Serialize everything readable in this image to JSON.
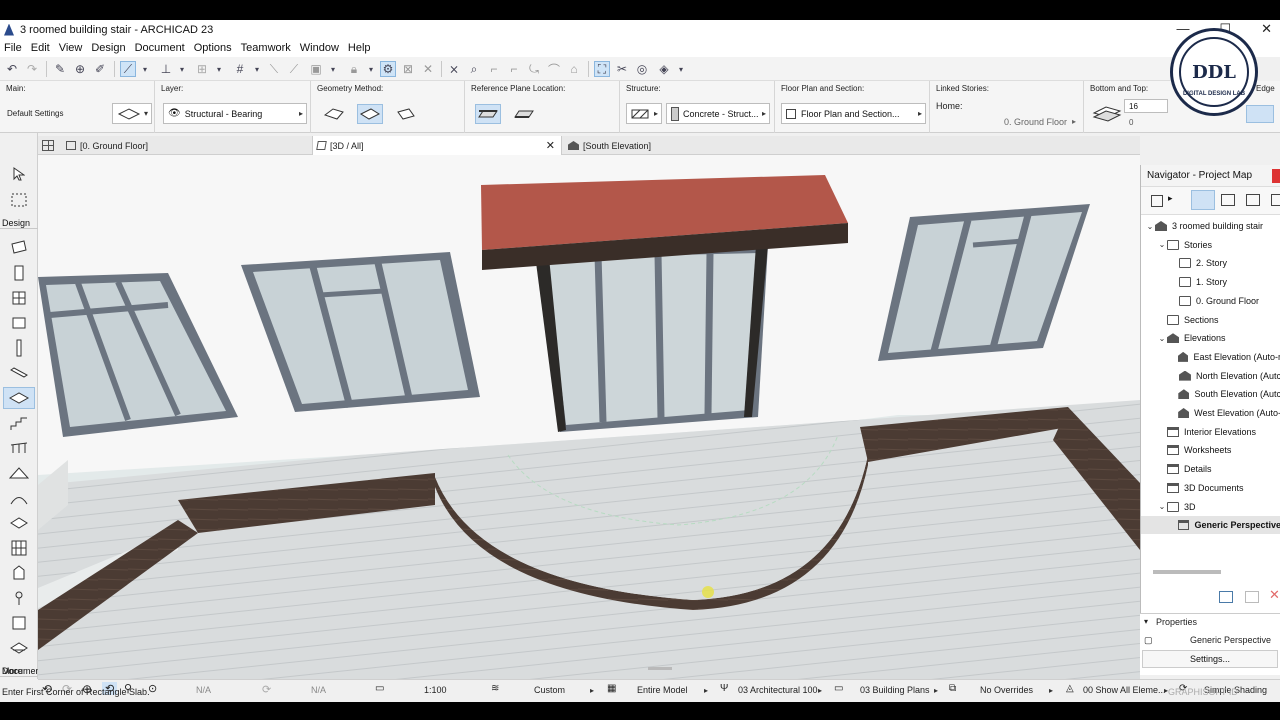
{
  "window": {
    "title": "3 roomed building stair - ARCHICAD 23",
    "minimize": "—",
    "maximize": "☐",
    "close": "✕"
  },
  "menu": [
    "File",
    "Edit",
    "View",
    "Design",
    "Document",
    "Options",
    "Teamwork",
    "Window",
    "Help"
  ],
  "infobox": {
    "main_label": "Main:",
    "main_value": "Default Settings",
    "layer_label": "Layer:",
    "layer_value": "Structural - Bearing",
    "geometry_label": "Geometry Method:",
    "refplane_label": "Reference Plane Location:",
    "structure_label": "Structure:",
    "structure_value": "Concrete - Struct...",
    "floorplan_label": "Floor Plan and Section:",
    "floorplan_value": "Floor Plan and Section...",
    "linked_label": "Linked Stories:",
    "linked_home": "Home:",
    "linked_value": "0. Ground Floor",
    "bottomtop_label": "Bottom and Top:",
    "bottomtop_top": "16",
    "bottomtop_bottom": "0",
    "edge_label": "Edge"
  },
  "tabs": [
    {
      "label": "[0. Ground Floor]"
    },
    {
      "label": "[3D / All]",
      "close": "✕"
    },
    {
      "label": "[South Elevation]"
    }
  ],
  "toolbox": {
    "design": "Design",
    "document": "Documen",
    "more": "More"
  },
  "navigator": {
    "title": "Navigator - Project Map",
    "tree": [
      {
        "label": "3 roomed building stair",
        "indent": 0,
        "tw": "⌄",
        "icon": "house"
      },
      {
        "label": "Stories",
        "indent": 1,
        "tw": "⌄",
        "icon": "folder"
      },
      {
        "label": "2. Story",
        "indent": 2,
        "tw": "",
        "icon": "folder"
      },
      {
        "label": "1. Story",
        "indent": 2,
        "tw": "",
        "icon": "folder"
      },
      {
        "label": "0. Ground Floor",
        "indent": 2,
        "tw": "",
        "icon": "folder"
      },
      {
        "label": "Sections",
        "indent": 1,
        "tw": "",
        "icon": "folder"
      },
      {
        "label": "Elevations",
        "indent": 1,
        "tw": "⌄",
        "icon": "house"
      },
      {
        "label": "East Elevation (Auto-r",
        "indent": 2,
        "tw": "",
        "icon": "house"
      },
      {
        "label": "North Elevation (Autc",
        "indent": 2,
        "tw": "",
        "icon": "house"
      },
      {
        "label": "South Elevation (Autc",
        "indent": 2,
        "tw": "",
        "icon": "house"
      },
      {
        "label": "West Elevation (Auto-",
        "indent": 2,
        "tw": "",
        "icon": "house"
      },
      {
        "label": "Interior Elevations",
        "indent": 1,
        "tw": "",
        "icon": "sheet"
      },
      {
        "label": "Worksheets",
        "indent": 1,
        "tw": "",
        "icon": "sheet"
      },
      {
        "label": "Details",
        "indent": 1,
        "tw": "",
        "icon": "sheet"
      },
      {
        "label": "3D Documents",
        "indent": 1,
        "tw": "",
        "icon": "sheet"
      },
      {
        "label": "3D",
        "indent": 1,
        "tw": "⌄",
        "icon": "folder"
      },
      {
        "label": "Generic Perspective",
        "indent": 2,
        "tw": "",
        "icon": "sheet",
        "selected": true
      }
    ],
    "properties_label": "Properties",
    "properties_value": "Generic Perspective",
    "settings_label": "Settings..."
  },
  "statusbar": {
    "na1": "N/A",
    "na2": "N/A",
    "scale": "1:100",
    "custom": "Custom",
    "model": "Entire Model",
    "penset": "03 Architectural 100",
    "mvo": "03 Building Plans",
    "overrides": "No Overrides",
    "renovation": "00 Show All Eleme...",
    "shading": "Simple Shading"
  },
  "prompt": "Enter First Corner of Rectangle Slab.",
  "graphisoft": "GRAPHISOFT ID",
  "logo": {
    "letters": "DDL",
    "ring": "DIGITAL DESIGN LAB"
  },
  "colors": {
    "roof": "#b3574a",
    "wall": "#f6f6f6",
    "deck": "#d8dbdb",
    "window_frame": "#6b7480",
    "glass": "#c9d3d7",
    "skirt": "#4a3a33"
  }
}
